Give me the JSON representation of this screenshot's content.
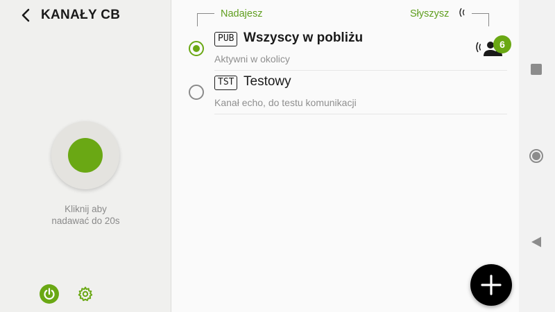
{
  "header": {
    "title": "KANAŁY CB",
    "back_icon": "chevron-left-icon"
  },
  "ptt": {
    "hint_line1": "Kliknij aby",
    "hint_line2": "nadawać do 20s",
    "color": "#6aa814"
  },
  "footer_controls": {
    "power_icon": "power-icon",
    "settings_icon": "gear-icon"
  },
  "columns": {
    "send_label": "Nadajesz",
    "hear_label": "Słyszysz"
  },
  "channels": [
    {
      "tag": "PUB",
      "name": "Wszyscy w pobliżu",
      "description": "Aktywni w okolicy",
      "selected": true,
      "listeners": "6"
    },
    {
      "tag": "TST",
      "name": "Testowy",
      "description": "Kanał echo, do testu komunikacji",
      "selected": false
    }
  ],
  "fab": {
    "icon": "plus-icon"
  },
  "navbar": {
    "recents_icon": "square-icon",
    "home_icon": "circle-icon",
    "back_icon": "triangle-back-icon"
  },
  "colors": {
    "accent": "#6aa814",
    "fab": "#000000"
  }
}
